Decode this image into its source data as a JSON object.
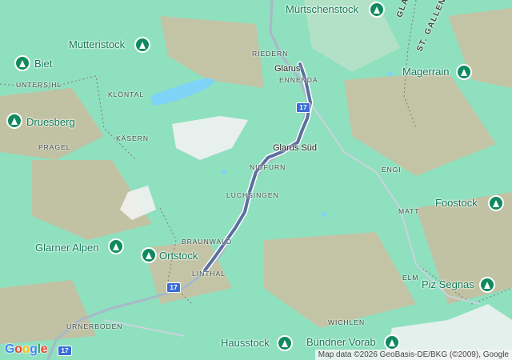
{
  "map": {
    "peaks": [
      {
        "name": "Mürtschenstock"
      },
      {
        "name": "Mutteristock"
      },
      {
        "name": "Biet"
      },
      {
        "name": "Magerrain"
      },
      {
        "name": "Druesberg"
      },
      {
        "name": "Foostock"
      },
      {
        "name": "Glarner Alpen"
      },
      {
        "name": "Ortstock"
      },
      {
        "name": "Piz Segnas"
      },
      {
        "name": "Hausstock"
      },
      {
        "name": "Bündner Vorab"
      }
    ],
    "towns": [
      {
        "name": "Glarus"
      },
      {
        "name": "Glarus Süd"
      }
    ],
    "places": [
      {
        "name": "RIEDERN"
      },
      {
        "name": "ENNENDA"
      },
      {
        "name": "UNTERSIHL"
      },
      {
        "name": "KLÖNTAL"
      },
      {
        "name": "PRAGEL"
      },
      {
        "name": "KÄSERN"
      },
      {
        "name": "NIDFURN"
      },
      {
        "name": "LUCHSINGEN"
      },
      {
        "name": "ENGI"
      },
      {
        "name": "MATT"
      },
      {
        "name": "BRAUNWALD"
      },
      {
        "name": "LINTHAL"
      },
      {
        "name": "ELM"
      },
      {
        "name": "URNERBODEN"
      },
      {
        "name": "WICHLEN"
      }
    ],
    "regions": [
      {
        "name": "GLARUS"
      },
      {
        "name": "ST. GALLEN"
      }
    ],
    "road_shields": [
      {
        "label": "17"
      },
      {
        "label": "17"
      },
      {
        "label": "17"
      }
    ],
    "colors": {
      "route": "#5a6f9e",
      "peak_marker": "#0f8a5f",
      "water": "#7fd3f7",
      "road": "#a8b8c8",
      "shield": "#3a6cd6"
    }
  },
  "branding": {
    "logo_letters": [
      "G",
      "o",
      "o",
      "g",
      "l",
      "e"
    ],
    "logo_colors": [
      "#4285F4",
      "#EA4335",
      "#FBBC05",
      "#4285F4",
      "#34A853",
      "#EA4335"
    ]
  },
  "attribution": "Map data ©2026 GeoBasis-DE/BKG (©2009), Google"
}
